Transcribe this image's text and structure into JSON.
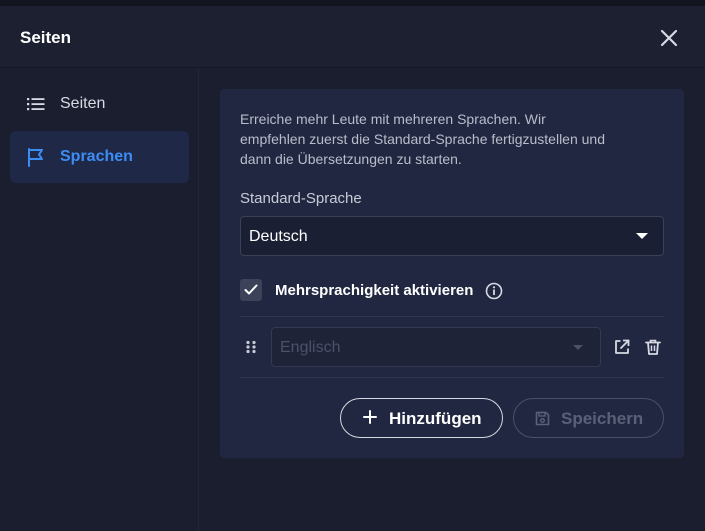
{
  "dialog": {
    "title": "Seiten",
    "close_icon": "close-icon"
  },
  "sidebar": {
    "items": [
      {
        "label": "Seiten",
        "icon": "list-icon",
        "active": false
      },
      {
        "label": "Sprachen",
        "icon": "flag-icon",
        "active": true
      }
    ]
  },
  "content": {
    "description_lines": [
      "Erreiche mehr Leute mit mehreren Sprachen. Wir",
      "empfehlen zuerst die Standard-Sprache fertigzustellen und",
      "dann die Übersetzungen zu starten."
    ],
    "default_language_label": "Standard-Sprache",
    "default_language_value": "Deutsch",
    "multilang_checkbox": {
      "label": "Mehrsprachigkeit aktivieren",
      "checked": true
    },
    "language_rows": [
      {
        "value": "Englisch",
        "disabled": true
      }
    ],
    "add_button_label": "Hinzufügen",
    "save_button_label": "Speichern"
  },
  "colors": {
    "accent": "#3b8df5",
    "background": "#1a1e2f",
    "card": "#222741"
  }
}
